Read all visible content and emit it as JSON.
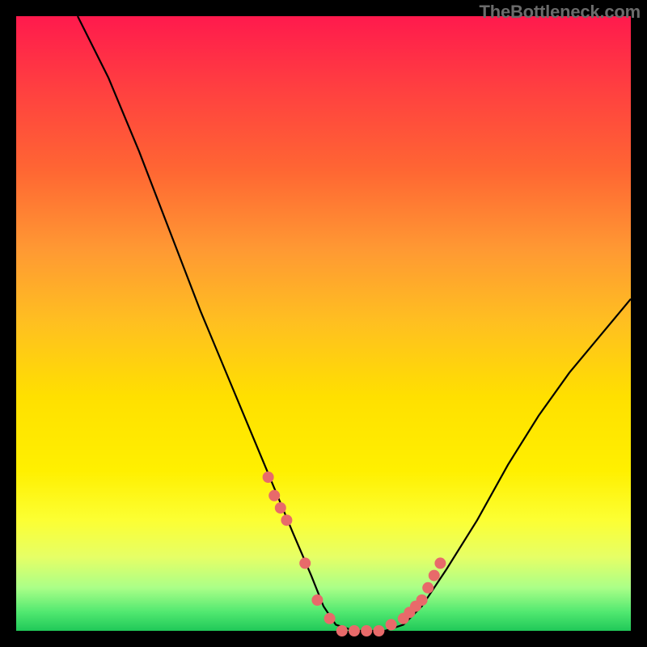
{
  "watermark": "TheBottleneck.com",
  "chart_data": {
    "type": "line",
    "title": "",
    "xlabel": "",
    "ylabel": "",
    "xlim": [
      0,
      100
    ],
    "ylim": [
      0,
      100
    ],
    "curve": {
      "name": "bottleneck-curve",
      "x": [
        10,
        15,
        20,
        25,
        30,
        35,
        40,
        45,
        48,
        50,
        52,
        55,
        58,
        60,
        63,
        66,
        70,
        75,
        80,
        85,
        90,
        95,
        100
      ],
      "y": [
        100,
        90,
        78,
        65,
        52,
        40,
        28,
        16,
        9,
        4,
        1,
        0,
        0,
        0,
        1,
        4,
        10,
        18,
        27,
        35,
        42,
        48,
        54
      ]
    },
    "markers": {
      "name": "highlight-range",
      "x": [
        41,
        42,
        43,
        44,
        47,
        49,
        51,
        53,
        55,
        57,
        59,
        61,
        63,
        64,
        65,
        66,
        67,
        68,
        69
      ],
      "y": [
        25,
        22,
        20,
        18,
        11,
        5,
        2,
        0,
        0,
        0,
        0,
        1,
        2,
        3,
        4,
        5,
        7,
        9,
        11
      ]
    },
    "background_gradient": {
      "top": "#ff1a4d",
      "mid": "#ffe000",
      "bottom": "#20c858"
    }
  }
}
